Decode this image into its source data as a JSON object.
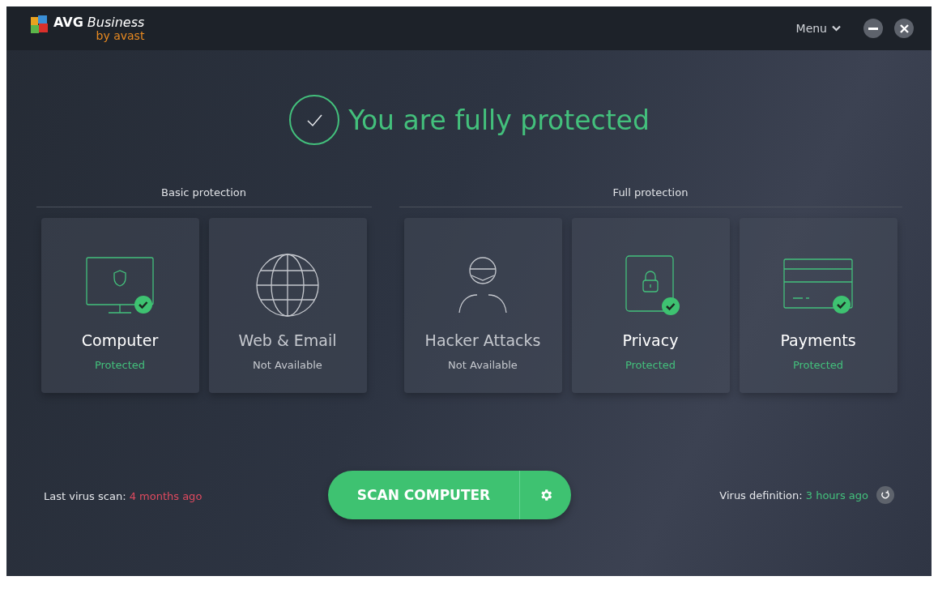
{
  "header": {
    "brand": "AVG",
    "brand_suffix": "Business",
    "byline": "by avast",
    "menu": "Menu"
  },
  "status": {
    "headline": "You are fully protected",
    "protected": true
  },
  "groups": [
    {
      "label": "Basic protection",
      "cards": [
        {
          "kind": "computer",
          "title": "Computer",
          "status": "Protected",
          "protected": true
        },
        {
          "kind": "web",
          "title": "Web & Email",
          "status": "Not Available",
          "protected": false
        }
      ]
    },
    {
      "label": "Full protection",
      "cards": [
        {
          "kind": "hacker",
          "title": "Hacker Attacks",
          "status": "Not Available",
          "protected": false
        },
        {
          "kind": "privacy",
          "title": "Privacy",
          "status": "Protected",
          "protected": true
        },
        {
          "kind": "payments",
          "title": "Payments",
          "status": "Protected",
          "protected": true
        }
      ]
    }
  ],
  "footer": {
    "last_scan_label": "Last virus scan:",
    "last_scan_value": "4 months ago",
    "scan_button": "SCAN COMPUTER",
    "definition_label": "Virus definition:",
    "definition_value": "3 hours ago"
  }
}
